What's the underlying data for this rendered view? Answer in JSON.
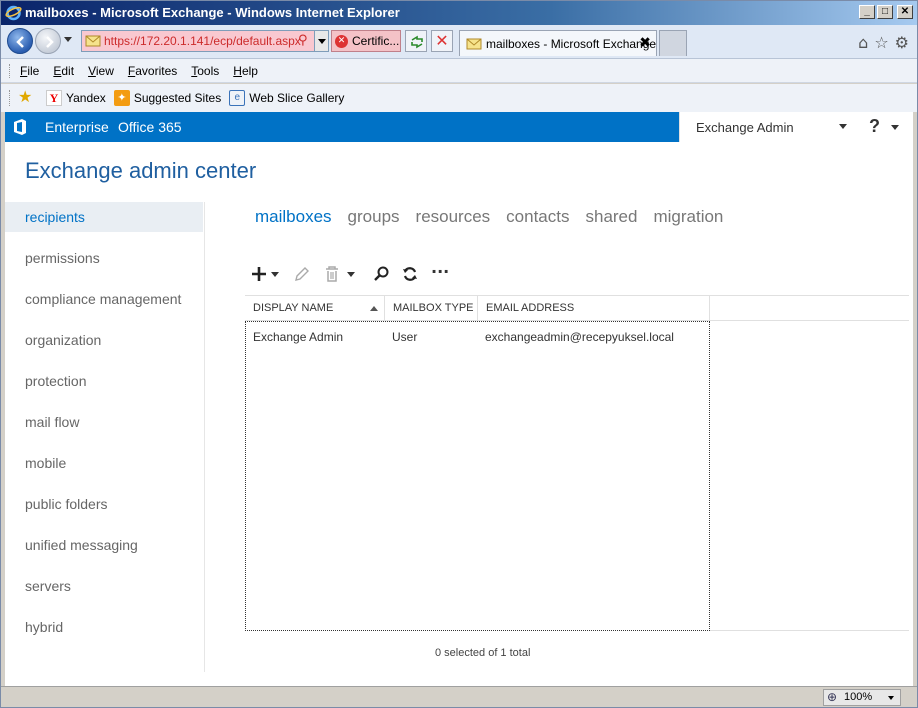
{
  "window": {
    "title": "mailboxes - Microsoft Exchange - Windows Internet Explorer",
    "buttons": {
      "minimize": "_",
      "maximize": "□",
      "close": "✕"
    }
  },
  "navbar": {
    "url": "https://172.20.1.141/ecp/default.aspx",
    "cert_label": "Certific...",
    "tab_label": "mailboxes - Microsoft Exchange",
    "tab_close": "✖"
  },
  "menubar": {
    "items": [
      "File",
      "Edit",
      "View",
      "Favorites",
      "Tools",
      "Help"
    ]
  },
  "favorites": {
    "items": [
      "Yandex",
      "Suggested Sites",
      "Web Slice Gallery"
    ]
  },
  "suitebar": {
    "enterprise": "Enterprise",
    "office365": "Office 365",
    "user": "Exchange Admin",
    "help": "?"
  },
  "page": {
    "title": "Exchange admin center"
  },
  "leftnav": {
    "items": [
      {
        "label": "recipients",
        "active": true
      },
      {
        "label": "permissions"
      },
      {
        "label": "compliance management"
      },
      {
        "label": "organization"
      },
      {
        "label": "protection"
      },
      {
        "label": "mail flow"
      },
      {
        "label": "mobile"
      },
      {
        "label": "public folders"
      },
      {
        "label": "unified messaging"
      },
      {
        "label": "servers"
      },
      {
        "label": "hybrid"
      }
    ]
  },
  "subtabs": {
    "items": [
      {
        "label": "mailboxes",
        "active": true
      },
      {
        "label": "groups"
      },
      {
        "label": "resources"
      },
      {
        "label": "contacts"
      },
      {
        "label": "shared"
      },
      {
        "label": "migration"
      }
    ]
  },
  "toolbar": {
    "more": "···"
  },
  "grid": {
    "columns": [
      "DISPLAY NAME",
      "MAILBOX TYPE",
      "EMAIL ADDRESS"
    ],
    "rows": [
      {
        "display_name": "Exchange Admin",
        "mailbox_type": "User",
        "email": "exchangeadmin@recepyuksel.local"
      }
    ],
    "status": "0 selected of 1 total"
  },
  "statusbar": {
    "zoom": "100%"
  },
  "colors": {
    "suitebar": "#0072c6",
    "accent": "#0072c6",
    "title": "#1f5fa0"
  }
}
